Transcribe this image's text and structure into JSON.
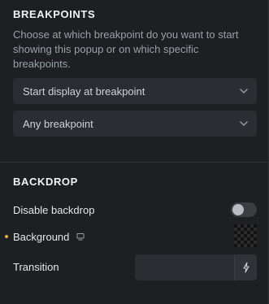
{
  "breakpoints": {
    "title": "BREAKPOINTS",
    "description": "Choose at which breakpoint do you want to start showing this popup or on which specific breakpoints.",
    "start_select": "Start display at breakpoint",
    "specific_select": "Any breakpoint"
  },
  "backdrop": {
    "title": "BACKDROP",
    "disable_label": "Disable backdrop",
    "disable_checked": false,
    "background_label": "Background",
    "transition_label": "Transition",
    "transition_value": ""
  },
  "colors": {
    "panel_bg": "#1d1f22",
    "control_bg": "#2a2d31",
    "indicator_dot": "#e4b23f"
  },
  "icons": {
    "select_arrow": "chevron-down-icon",
    "responsive": "screen-icon",
    "dynamic_data": "bolt-icon"
  }
}
